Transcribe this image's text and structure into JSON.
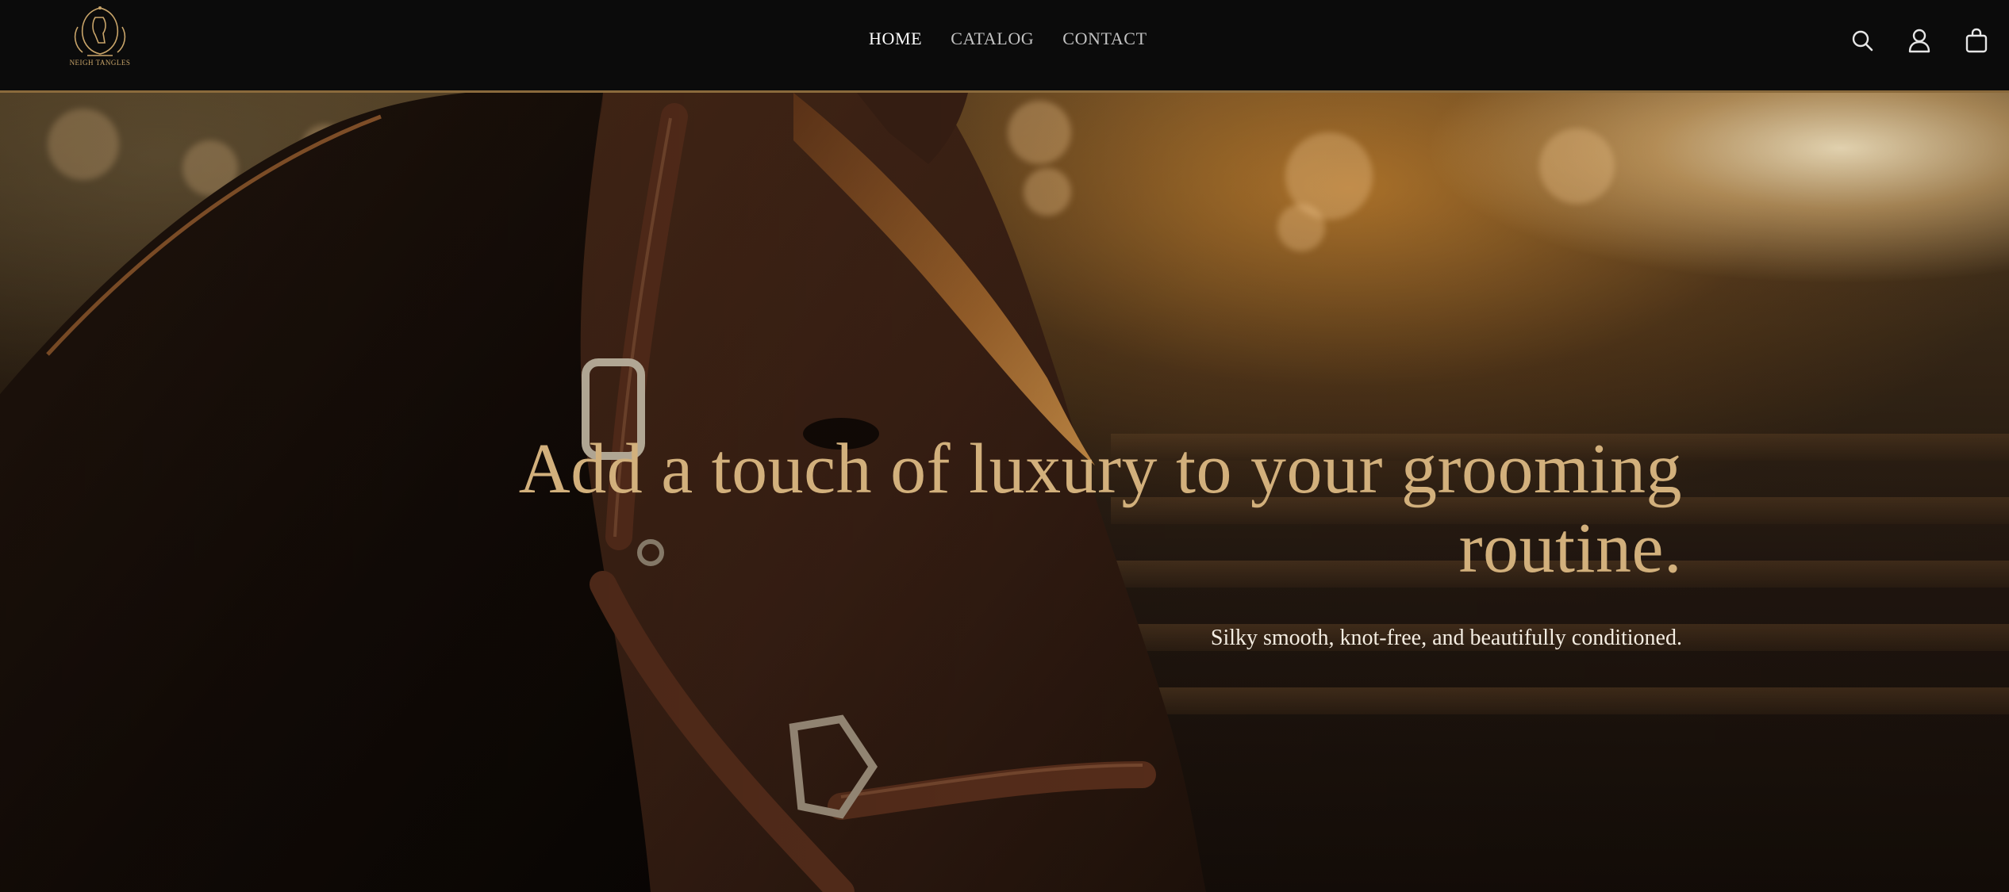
{
  "brand": {
    "logo_text": "NEIGH TANGLES",
    "accent_color": "#c9a56a"
  },
  "nav": {
    "items": [
      {
        "label": "HOME",
        "active": true
      },
      {
        "label": "CATALOG",
        "active": false
      },
      {
        "label": "CONTACT",
        "active": false
      }
    ]
  },
  "header_icons": [
    "search-icon",
    "account-icon",
    "cart-icon"
  ],
  "hero": {
    "title": "Add a touch of luxury to your grooming routine.",
    "subtitle": "Silky smooth, knot-free, and beautifully conditioned.",
    "title_color": "#d2b07c"
  }
}
